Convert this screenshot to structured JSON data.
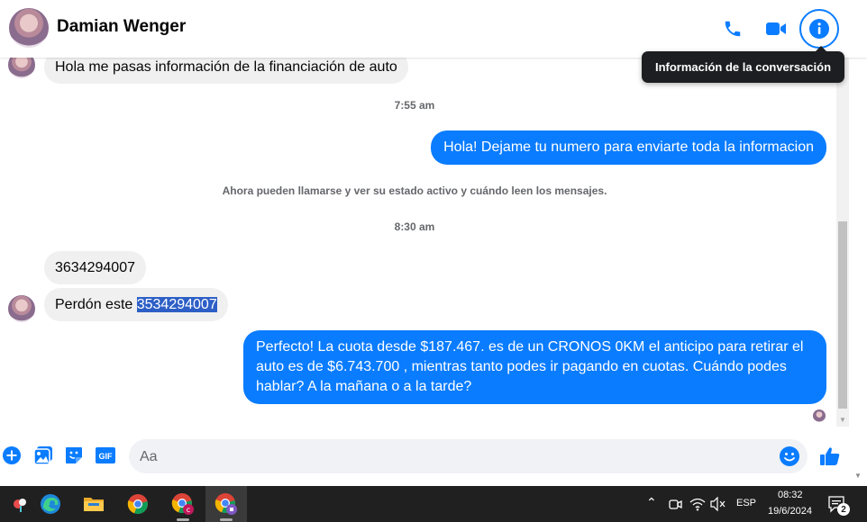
{
  "header": {
    "contact_name": "Damian Wenger",
    "tooltip": "Información de la conversación"
  },
  "messages": {
    "first_incoming": "Hola me pasas información de la financiación de auto",
    "time1": "7:55 am",
    "outgoing1": "Hola! Dejame tu numero para enviarte toda la informacion",
    "system_notice": "Ahora pueden llamarse y ver su estado activo y cuándo leen los mensajes.",
    "time2": "8:30 am",
    "incoming_number": "3634294007",
    "incoming2_prefix": "Perdón este ",
    "incoming2_selected": "3534294007",
    "outgoing2": "Perfecto! La cuota desde $187.467. es de un CRONOS 0KM el anticipo para retirar el auto es de $6.743.700 , mientras tanto podes ir pagando en cuotas. Cuándo podes hablar? A la mañana o a la tarde?"
  },
  "composer": {
    "placeholder": "Aa"
  },
  "taskbar": {
    "language": "ESP",
    "time": "08:32",
    "date": "19/6/2024",
    "notification_count": "2"
  },
  "colors": {
    "accent": "#0a7cff",
    "incoming_bubble": "#f0f0f0",
    "taskbar": "#202020"
  }
}
